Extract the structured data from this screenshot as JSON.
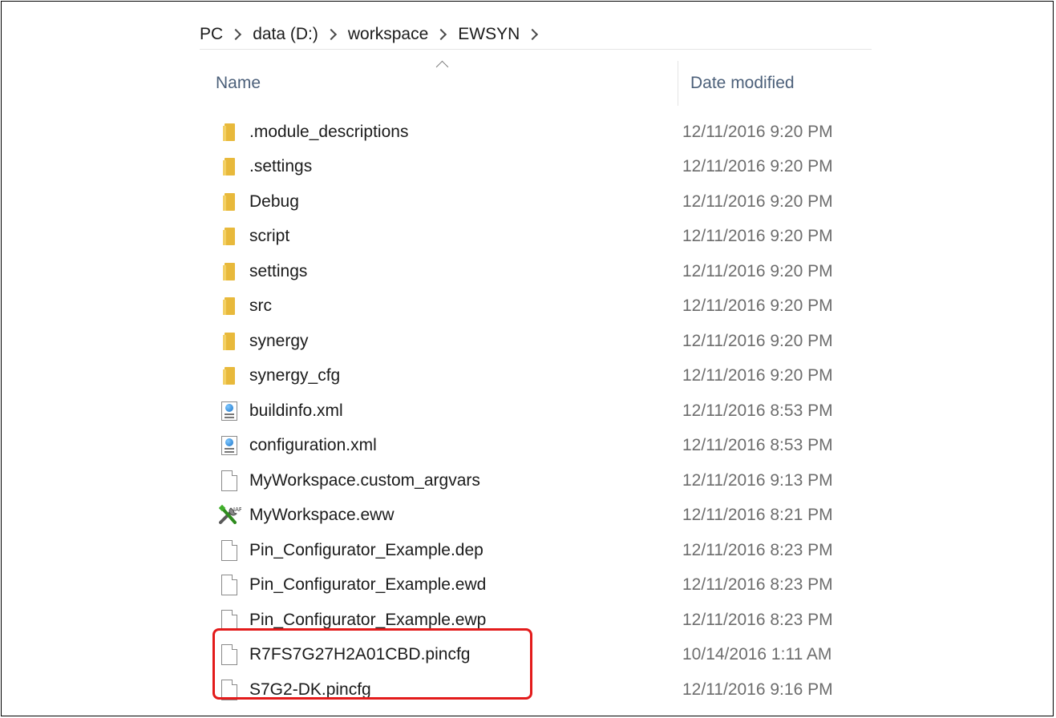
{
  "breadcrumb": {
    "items": [
      "PC",
      "data (D:)",
      "workspace",
      "EWSYN"
    ]
  },
  "columns": {
    "name": "Name",
    "date_modified": "Date modified"
  },
  "files": [
    {
      "name": ".module_descriptions",
      "date": "12/11/2016 9:20 PM",
      "icon": "folder-icon"
    },
    {
      "name": ".settings",
      "date": "12/11/2016 9:20 PM",
      "icon": "folder-icon"
    },
    {
      "name": "Debug",
      "date": "12/11/2016 9:20 PM",
      "icon": "folder-icon"
    },
    {
      "name": "script",
      "date": "12/11/2016 9:20 PM",
      "icon": "folder-icon"
    },
    {
      "name": "settings",
      "date": "12/11/2016 9:20 PM",
      "icon": "folder-icon"
    },
    {
      "name": "src",
      "date": "12/11/2016 9:20 PM",
      "icon": "folder-icon"
    },
    {
      "name": "synergy",
      "date": "12/11/2016 9:20 PM",
      "icon": "folder-icon"
    },
    {
      "name": "synergy_cfg",
      "date": "12/11/2016 9:20 PM",
      "icon": "folder-icon"
    },
    {
      "name": "buildinfo.xml",
      "date": "12/11/2016 8:53 PM",
      "icon": "xml-file-icon"
    },
    {
      "name": "configuration.xml",
      "date": "12/11/2016 8:53 PM",
      "icon": "xml-file-icon"
    },
    {
      "name": "MyWorkspace.custom_argvars",
      "date": "12/11/2016 9:13 PM",
      "icon": "file-icon"
    },
    {
      "name": "MyWorkspace.eww",
      "date": "12/11/2016 8:21 PM",
      "icon": "workspace-tool-icon"
    },
    {
      "name": "Pin_Configurator_Example.dep",
      "date": "12/11/2016 8:23 PM",
      "icon": "file-icon"
    },
    {
      "name": "Pin_Configurator_Example.ewd",
      "date": "12/11/2016 8:23 PM",
      "icon": "file-icon"
    },
    {
      "name": "Pin_Configurator_Example.ewp",
      "date": "12/11/2016 8:23 PM",
      "icon": "file-icon"
    },
    {
      "name": "R7FS7G27H2A01CBD.pincfg",
      "date": "10/14/2016 1:11 AM",
      "icon": "file-icon"
    },
    {
      "name": "S7G2-DK.pincfg",
      "date": "12/11/2016 9:16 PM",
      "icon": "file-icon"
    }
  ],
  "colors": {
    "folder": "#e8b93b",
    "header_text": "#4c607a",
    "highlight": "#e31b1b"
  }
}
